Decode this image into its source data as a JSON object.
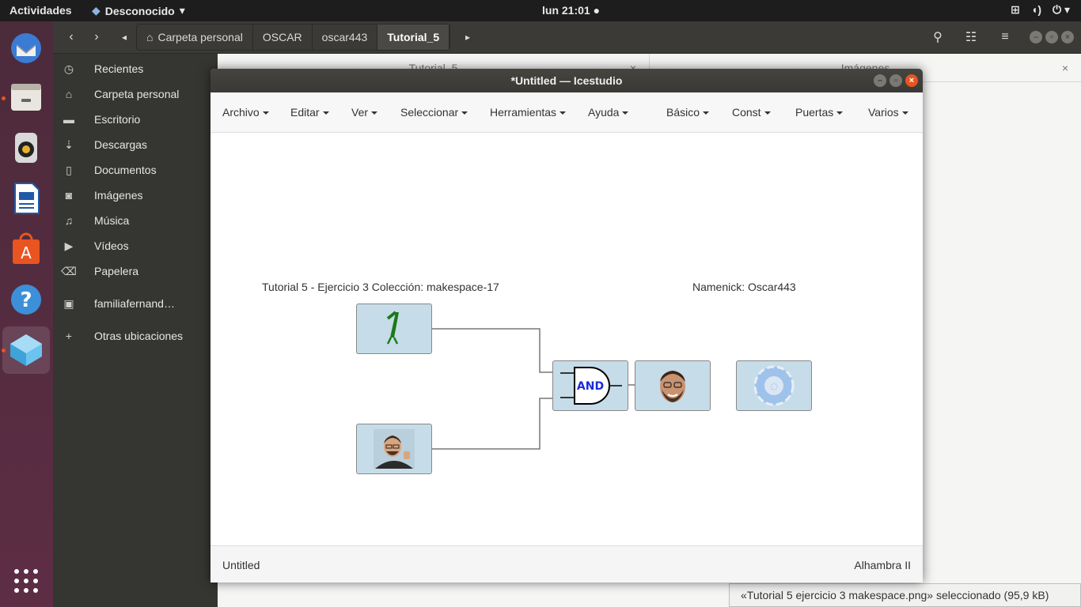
{
  "topbar": {
    "activities": "Actividades",
    "app_name": "Desconocido",
    "clock": "lun 21:01"
  },
  "dock": {
    "items": [
      "thunderbird-icon",
      "files-icon",
      "rhythmbox-icon",
      "writer-icon",
      "software-center-icon",
      "help-icon",
      "icestudio-icon"
    ],
    "apps_grid": "show-applications-icon"
  },
  "nautilus": {
    "breadcrumbs": [
      "Carpeta personal",
      "OSCAR",
      "oscar443",
      "Tutorial_5"
    ],
    "sidebar": [
      "Recientes",
      "Carpeta personal",
      "Escritorio",
      "Descargas",
      "Documentos",
      "Imágenes",
      "Música",
      "Vídeos",
      "Papelera",
      "familiafernand…",
      "Otras ubicaciones"
    ],
    "tabs": [
      "Tutorial_5",
      "Imágenes"
    ],
    "status": "«Tutorial 5 ejercicio 3 makespace.png» seleccionado  (95,9 kB)"
  },
  "icestudio": {
    "title": "*Untitled — Icestudio",
    "menus": [
      "Archivo",
      "Editar",
      "Ver",
      "Seleccionar",
      "Herramientas",
      "Ayuda",
      "Básico",
      "Const",
      "Puertas",
      "Varios"
    ],
    "info_left": "Tutorial 5 - Ejercicio 3 Colección: makespace-17",
    "info_right": "Namenick: Oscar443",
    "gate_label": "AND",
    "status_left": "Untitled",
    "status_right": "Alhambra II"
  },
  "colors": {
    "topbar": "#1d1d1d",
    "dock": "#5a2a3e",
    "block": "#c6dce8",
    "accent": "#e95420"
  }
}
